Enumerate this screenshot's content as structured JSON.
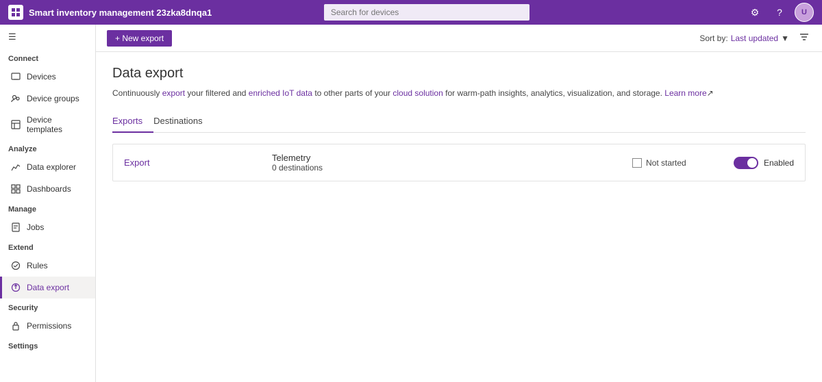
{
  "topnav": {
    "app_name": "Smart inventory management 23zka8dnqa1",
    "search_placeholder": "Search for devices",
    "icons": [
      "settings-icon",
      "help-icon",
      "account-icon"
    ]
  },
  "sidebar": {
    "hamburger_label": "☰",
    "sections": [
      {
        "label": "Connect",
        "items": [
          {
            "id": "devices",
            "label": "Devices",
            "icon": "device-icon"
          },
          {
            "id": "device-groups",
            "label": "Device groups",
            "icon": "groups-icon"
          },
          {
            "id": "device-templates",
            "label": "Device templates",
            "icon": "templates-icon"
          }
        ]
      },
      {
        "label": "Analyze",
        "items": [
          {
            "id": "data-explorer",
            "label": "Data explorer",
            "icon": "chart-icon"
          },
          {
            "id": "dashboards",
            "label": "Dashboards",
            "icon": "dashboard-icon"
          }
        ]
      },
      {
        "label": "Manage",
        "items": [
          {
            "id": "jobs",
            "label": "Jobs",
            "icon": "jobs-icon"
          }
        ]
      },
      {
        "label": "Extend",
        "items": [
          {
            "id": "rules",
            "label": "Rules",
            "icon": "rules-icon"
          },
          {
            "id": "data-export",
            "label": "Data export",
            "icon": "export-icon",
            "active": true
          }
        ]
      },
      {
        "label": "Security",
        "items": [
          {
            "id": "permissions",
            "label": "Permissions",
            "icon": "permissions-icon"
          }
        ]
      },
      {
        "label": "Settings",
        "items": []
      }
    ]
  },
  "toolbar": {
    "new_export_label": "+ New export",
    "sort_prefix": "Sort by:",
    "sort_value": "Last updated",
    "filter_icon": "▼"
  },
  "page": {
    "title": "Data export",
    "description_parts": [
      "Continuously ",
      "export",
      " your filtered and enriched IoT data to other parts of your cloud solution for warm-path insights, analytics, visualization, and storage. ",
      "Learn more"
    ],
    "description_text": "Continuously export your filtered and enriched IoT data to other parts of your cloud solution for warm-path insights, analytics, visualization, and storage.",
    "learn_more": "Learn more"
  },
  "tabs": [
    {
      "id": "exports",
      "label": "Exports",
      "active": true
    },
    {
      "id": "destinations",
      "label": "Destinations",
      "active": false
    }
  ],
  "exports": [
    {
      "name": "Export",
      "type": "Telemetry",
      "destinations_count": "0 destinations",
      "status": "Not started",
      "enabled": true,
      "enabled_label": "Enabled"
    }
  ]
}
